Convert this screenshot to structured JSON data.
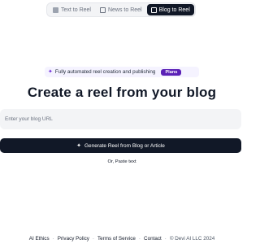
{
  "tabs": [
    {
      "label": "Text to Reel",
      "icon": "video-icon",
      "active": false
    },
    {
      "label": "News to Reel",
      "icon": "news-icon",
      "active": false
    },
    {
      "label": "Blog to Reel",
      "icon": "blog-icon",
      "active": true
    }
  ],
  "promo": {
    "icon": "magic-wand-icon",
    "text": "Fully automated reel creation and publishing",
    "plans_label": "Plans"
  },
  "main": {
    "title": "Create a reel from your blog",
    "url_placeholder": "Enter your blog URL",
    "url_value": "",
    "generate_label": "Generate Reel from Blog or Article",
    "generate_icon": "magic-wand-icon",
    "paste_text": "Or, Paste text"
  },
  "footer": {
    "links": [
      "AI Ethics",
      "Privacy Policy",
      "Terms of Service",
      "Contact"
    ],
    "copyright": "© Devi AI LLC 2024"
  },
  "colors": {
    "accent": "#5b21b6",
    "dark": "#111827",
    "input_bg": "#f3f4f6",
    "promo_bg": "#f5f3ff"
  }
}
